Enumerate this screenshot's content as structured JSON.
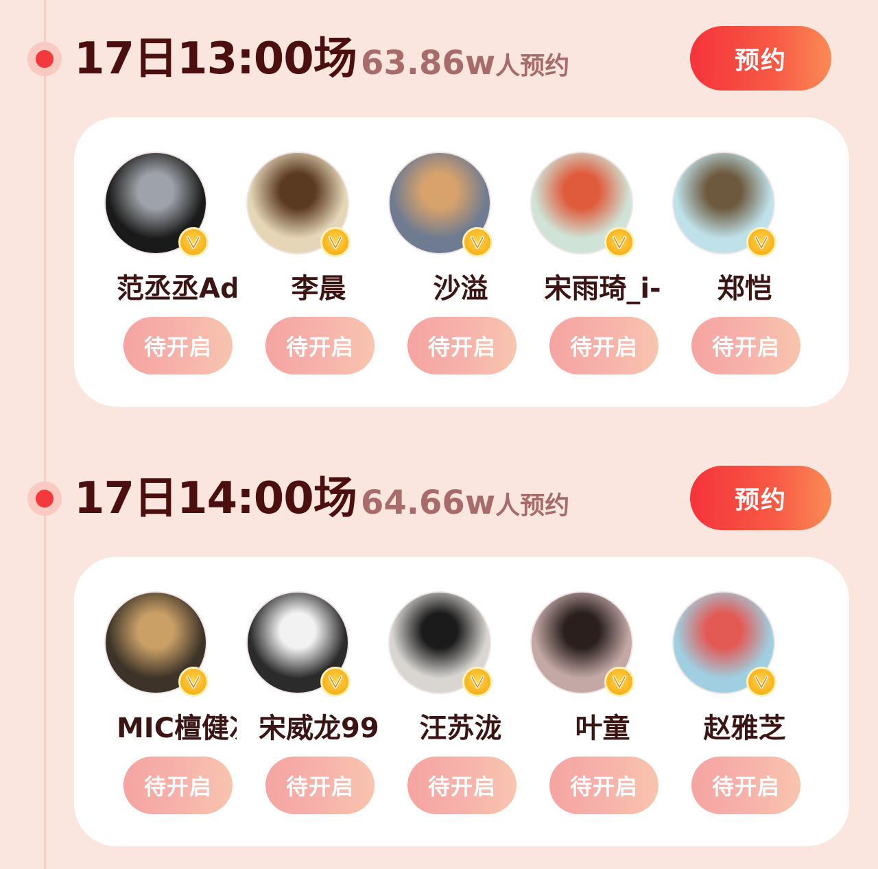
{
  "sessions": [
    {
      "title": "17日13:00场",
      "count_value": "63.86w",
      "count_suffix": "人预约",
      "button_label": "预约",
      "guests": [
        {
          "name": "范丞丞Ad",
          "status": "待开启",
          "avatar_colors": [
            "#1a1a1a",
            "#9ea3aa"
          ]
        },
        {
          "name": "李晨",
          "status": "待开启",
          "avatar_colors": [
            "#e5d6b8",
            "#5b3a22"
          ]
        },
        {
          "name": "沙溢",
          "status": "待开启",
          "avatar_colors": [
            "#6e7b91",
            "#d7a26b"
          ]
        },
        {
          "name": "宋雨琦_i-",
          "status": "待开启",
          "avatar_colors": [
            "#cfe3d6",
            "#e05b3c"
          ]
        },
        {
          "name": "郑恺",
          "status": "待开启",
          "avatar_colors": [
            "#bfe1ea",
            "#6d5a3e"
          ]
        }
      ]
    },
    {
      "title": "17日14:00场",
      "count_value": "64.66w",
      "count_suffix": "人预约",
      "button_label": "预约",
      "guests": [
        {
          "name": "MIC檀健次",
          "status": "待开启",
          "avatar_colors": [
            "#3d3328",
            "#caa067"
          ]
        },
        {
          "name": "宋威龙99",
          "status": "待开启",
          "avatar_colors": [
            "#2b2b2b",
            "#f2f2f2"
          ]
        },
        {
          "name": "汪苏泷",
          "status": "待开启",
          "avatar_colors": [
            "#d9d6d2",
            "#1b1b1b"
          ]
        },
        {
          "name": "叶童",
          "status": "待开启",
          "avatar_colors": [
            "#c3a8a5",
            "#2a1f1d"
          ]
        },
        {
          "name": "赵雅芝",
          "status": "待开启",
          "avatar_colors": [
            "#9fcfe0",
            "#e35a55"
          ]
        }
      ]
    }
  ],
  "colors": {
    "background": "#fbe6df",
    "accent_red": "#f3393c",
    "title_text": "#4a0f0e",
    "count_text": "#a66b6a",
    "badge_gold": "#f8b21c"
  },
  "icons": {
    "timeline_dot": "timeline-dot-icon",
    "verified_badge": "verified-v-badge-icon"
  }
}
